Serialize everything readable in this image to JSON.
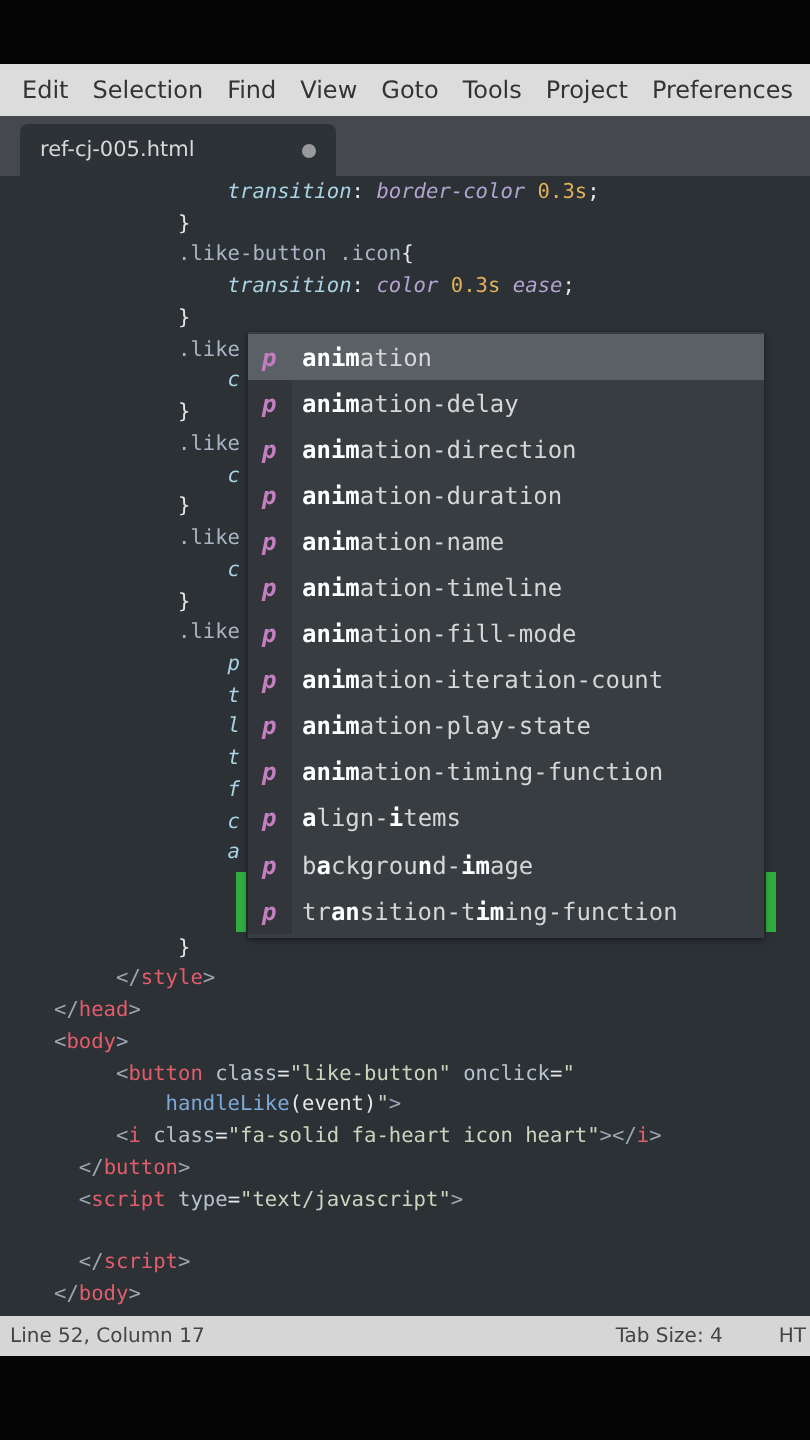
{
  "menu": [
    {
      "label": "Edit"
    },
    {
      "label": "Selection"
    },
    {
      "label": "Find"
    },
    {
      "label": "View"
    },
    {
      "label": "Goto"
    },
    {
      "label": "Tools"
    },
    {
      "label": "Project"
    },
    {
      "label": "Preferences"
    }
  ],
  "tabs": [
    {
      "label": "ref-cj-005.html",
      "selected": true,
      "modified": true
    }
  ],
  "code_lines": [
    {
      "tokens": [
        {
          "kind": "prop",
          "text": "              transition"
        },
        {
          "kind": "punct",
          "text": ": "
        },
        {
          "kind": "val",
          "text": "border-color "
        },
        {
          "kind": "num",
          "text": "0.3s"
        },
        {
          "kind": "punct",
          "text": ";"
        }
      ]
    },
    {
      "tokens": [
        {
          "kind": "punct",
          "text": "          }"
        }
      ]
    },
    {
      "tokens": [
        {
          "kind": "sel",
          "text": "          .like-button .icon"
        },
        {
          "kind": "punct",
          "text": "{"
        }
      ]
    },
    {
      "tokens": [
        {
          "kind": "prop",
          "text": "              transition"
        },
        {
          "kind": "punct",
          "text": ": "
        },
        {
          "kind": "val",
          "text": "color "
        },
        {
          "kind": "num",
          "text": "0.3s"
        },
        {
          "kind": "val",
          "text": " ease"
        },
        {
          "kind": "punct",
          "text": ";"
        }
      ]
    },
    {
      "tokens": [
        {
          "kind": "punct",
          "text": "          }"
        }
      ]
    },
    {
      "tokens": [
        {
          "kind": "sel",
          "text": "          .like"
        }
      ]
    },
    {
      "tokens": [
        {
          "kind": "prop",
          "text": "              c"
        }
      ]
    },
    {
      "tokens": [
        {
          "kind": "punct",
          "text": "          }"
        }
      ]
    },
    {
      "tokens": [
        {
          "kind": "sel",
          "text": "          .like"
        }
      ]
    },
    {
      "tokens": [
        {
          "kind": "prop",
          "text": "              c"
        }
      ]
    },
    {
      "tokens": [
        {
          "kind": "punct",
          "text": "          }"
        }
      ]
    },
    {
      "tokens": [
        {
          "kind": "sel",
          "text": "          .like"
        }
      ]
    },
    {
      "tokens": [
        {
          "kind": "prop",
          "text": "              c"
        }
      ]
    },
    {
      "tokens": [
        {
          "kind": "punct",
          "text": "          }"
        }
      ]
    },
    {
      "tokens": [
        {
          "kind": "sel",
          "text": "          .like"
        }
      ]
    },
    {
      "tokens": [
        {
          "kind": "prop",
          "text": "              p"
        }
      ]
    },
    {
      "tokens": [
        {
          "kind": "prop",
          "text": "              t"
        }
      ]
    },
    {
      "tokens": [
        {
          "kind": "prop",
          "text": "              l"
        }
      ]
    },
    {
      "tokens": [
        {
          "kind": "prop",
          "text": "              t"
        }
      ]
    },
    {
      "tokens": [
        {
          "kind": "prop",
          "text": "              f"
        }
      ]
    },
    {
      "tokens": [
        {
          "kind": "prop",
          "text": "              c"
        }
      ]
    },
    {
      "tokens": [
        {
          "kind": "prop",
          "text": "              a"
        }
      ]
    },
    {
      "kind": "blank"
    },
    {
      "kind": "blank"
    },
    {
      "tokens": [
        {
          "kind": "punct",
          "text": "          }"
        }
      ]
    },
    {
      "tokens": [
        {
          "kind": "bracket",
          "text": "     </"
        },
        {
          "kind": "tag",
          "text": "style"
        },
        {
          "kind": "bracket",
          "text": ">"
        }
      ]
    },
    {
      "tokens": [
        {
          "kind": "bracket",
          "text": "</"
        },
        {
          "kind": "tag",
          "text": "head"
        },
        {
          "kind": "bracket",
          "text": ">"
        }
      ]
    },
    {
      "tokens": [
        {
          "kind": "bracket",
          "text": "<"
        },
        {
          "kind": "tag",
          "text": "body"
        },
        {
          "kind": "bracket",
          "text": ">"
        }
      ]
    },
    {
      "tokens": [
        {
          "kind": "bracket",
          "text": "     <"
        },
        {
          "kind": "tag",
          "text": "button"
        },
        {
          "kind": "attr",
          "text": " class"
        },
        {
          "kind": "punct",
          "text": "="
        },
        {
          "kind": "str",
          "text": "\"like-button\""
        },
        {
          "kind": "attr",
          "text": " onclick"
        },
        {
          "kind": "punct",
          "text": "="
        },
        {
          "kind": "str",
          "text": "\""
        }
      ]
    },
    {
      "tokens": [
        {
          "kind": "fn",
          "text": "         handleLike"
        },
        {
          "kind": "punct",
          "text": "(event)"
        },
        {
          "kind": "str",
          "text": "\""
        },
        {
          "kind": "bracket",
          "text": ">"
        }
      ]
    },
    {
      "tokens": [
        {
          "kind": "bracket",
          "text": "     <"
        },
        {
          "kind": "tag",
          "text": "i"
        },
        {
          "kind": "attr",
          "text": " class"
        },
        {
          "kind": "punct",
          "text": "="
        },
        {
          "kind": "str",
          "text": "\"fa-solid fa-heart icon heart\""
        },
        {
          "kind": "bracket",
          "text": "></"
        },
        {
          "kind": "tag",
          "text": "i"
        },
        {
          "kind": "bracket",
          "text": ">"
        }
      ]
    },
    {
      "tokens": [
        {
          "kind": "bracket",
          "text": "  </"
        },
        {
          "kind": "tag",
          "text": "button"
        },
        {
          "kind": "bracket",
          "text": ">"
        }
      ]
    },
    {
      "tokens": [
        {
          "kind": "bracket",
          "text": "  <"
        },
        {
          "kind": "tag",
          "text": "script"
        },
        {
          "kind": "attr",
          "text": " type"
        },
        {
          "kind": "punct",
          "text": "="
        },
        {
          "kind": "str",
          "text": "\"text/javascript\""
        },
        {
          "kind": "bracket",
          "text": ">"
        }
      ]
    },
    {
      "kind": "blank"
    },
    {
      "tokens": [
        {
          "kind": "bracket",
          "text": "  </"
        },
        {
          "kind": "tag",
          "text": "script"
        },
        {
          "kind": "bracket",
          "text": ">"
        }
      ]
    },
    {
      "tokens": [
        {
          "kind": "bracket",
          "text": "</"
        },
        {
          "kind": "tag",
          "text": "body"
        },
        {
          "kind": "bracket",
          "text": ">"
        }
      ]
    }
  ],
  "autocomplete": [
    {
      "letter": "p",
      "label": "**anim**ation",
      "selected": true
    },
    {
      "letter": "p",
      "label": "**anim**ation-delay",
      "selected": false
    },
    {
      "letter": "p",
      "label": "**anim**ation-direction",
      "selected": false
    },
    {
      "letter": "p",
      "label": "**anim**ation-duration",
      "selected": false
    },
    {
      "letter": "p",
      "label": "**anim**ation-name",
      "selected": false
    },
    {
      "letter": "p",
      "label": "**anim**ation-timeline",
      "selected": false
    },
    {
      "letter": "p",
      "label": "**anim**ation-fill-mode",
      "selected": false
    },
    {
      "letter": "p",
      "label": "**anim**ation-iteration-count",
      "selected": false
    },
    {
      "letter": "p",
      "label": "**anim**ation-play-state",
      "selected": false
    },
    {
      "letter": "p",
      "label": "**anim**ation-timing-function",
      "selected": false
    },
    {
      "letter": "p",
      "label": "**a**lign-**i**tems",
      "selected": false
    },
    {
      "letter": "p",
      "label": "b**a**ckgrou**n**d-**im**age",
      "selected": false
    },
    {
      "letter": "p",
      "label": "tr**an**sition-t**im**ing-function",
      "selected": false
    }
  ],
  "status_bar": {
    "position": "Line 52, Column 17",
    "tab_size": "Tab Size: 4",
    "syntax": "HT"
  }
}
